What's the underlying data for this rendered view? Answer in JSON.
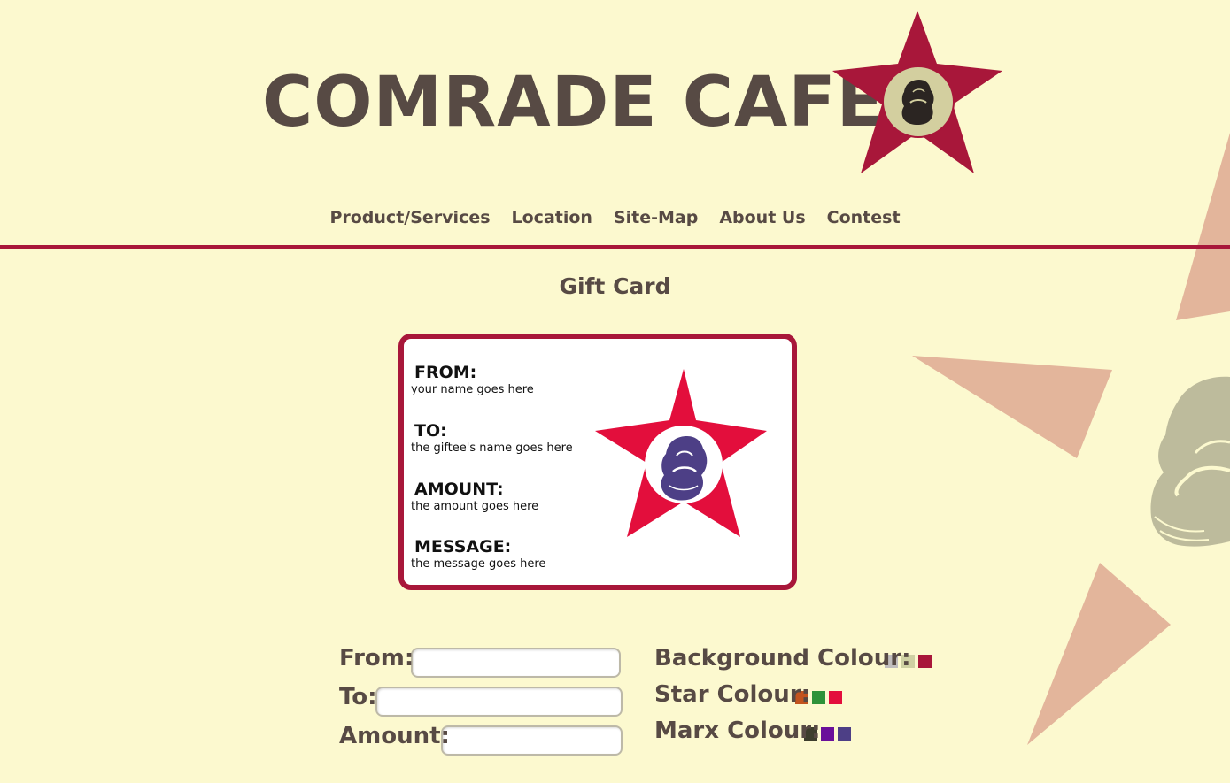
{
  "header": {
    "title": "COMRADE CAFE",
    "logo_icon": "red-star-marx-logo"
  },
  "nav": {
    "items": [
      {
        "label": "Product/Services"
      },
      {
        "label": "Location"
      },
      {
        "label": "Site-Map"
      },
      {
        "label": "About Us"
      },
      {
        "label": "Contest"
      }
    ]
  },
  "page": {
    "title": "Gift Card"
  },
  "card": {
    "fields": [
      {
        "label": "FROM:",
        "value": "your name goes here"
      },
      {
        "label": "TO:",
        "value": "the giftee's name goes here"
      },
      {
        "label": "AMOUNT:",
        "value": "the amount goes here"
      },
      {
        "label": "MESSAGE:",
        "value": "the message goes here"
      }
    ],
    "star_color": "#e30e3c",
    "marx_color": "#4d3f86",
    "background_color": "#ffffff",
    "border_color": "#a8173a"
  },
  "form": {
    "from_label": "From:",
    "to_label": "To:",
    "amount_label": "Amount:",
    "from_value": "",
    "to_value": "",
    "amount_value": ""
  },
  "options": {
    "background_label": "Background Colour:",
    "star_label": "Star Colour:",
    "marx_label": "Marx Colour:",
    "background_swatches": [
      "#c0bdbd",
      "#cfd1a3",
      "#a8173a"
    ],
    "star_swatches": [
      "#c2541e",
      "#2e9239",
      "#e30e3c"
    ],
    "marx_swatches": [
      "#3d3e2d",
      "#6a109a",
      "#4d3f86"
    ]
  },
  "colors": {
    "page_background": "#fcf9cf",
    "text": "#574a44",
    "accent": "#a8173a",
    "decor_star": "#e3b59b",
    "decor_marx": "#bdbb9c"
  }
}
